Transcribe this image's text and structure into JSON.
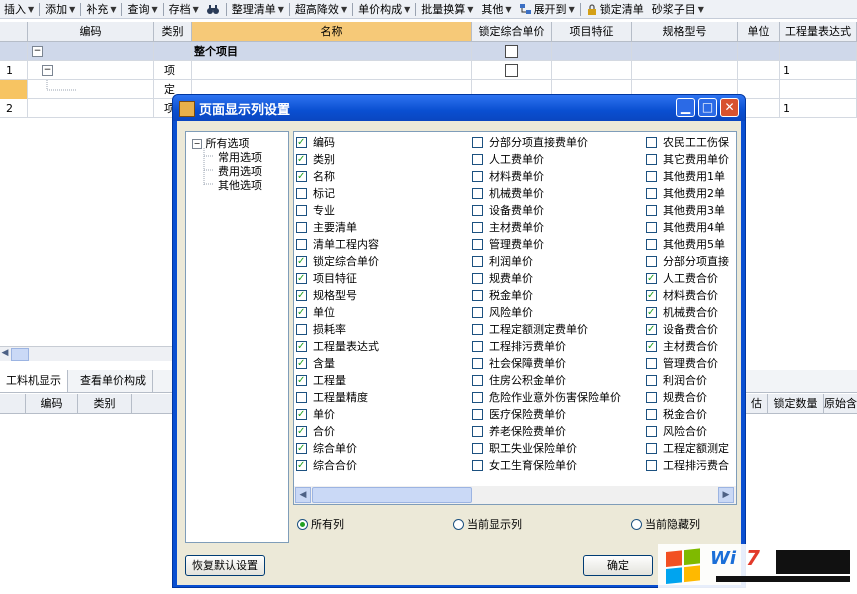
{
  "toolbar": {
    "items": [
      "插入",
      "添加",
      "补充",
      "查询",
      "存档",
      "整理清单",
      "超高降效",
      "单价构成",
      "批量换算",
      "其他",
      "展开到",
      "锁定清单",
      "砂浆子目"
    ]
  },
  "grid": {
    "headers": [
      "编码",
      "类别",
      "名称",
      "锁定综合单价",
      "项目特征",
      "规格型号",
      "单位",
      "工程量表达式"
    ],
    "rows": [
      {
        "num": "",
        "expander": "−",
        "name": "整个项目"
      },
      {
        "num": "1",
        "type": "项",
        "quantity": "1"
      },
      {
        "num": "",
        "type": "定"
      },
      {
        "num": "2",
        "type": "项",
        "quantity": "1"
      }
    ]
  },
  "lower_panel": {
    "tabs": [
      "工料机显示",
      "查看单价构成"
    ],
    "headers_left": [
      "编码",
      "类别"
    ],
    "headers_right": [
      "估",
      "锁定数量",
      "原始含"
    ]
  },
  "dialog": {
    "title": "页面显示列设置",
    "tree": {
      "root": "所有选项",
      "children": [
        "常用选项",
        "费用选项",
        "其他选项"
      ]
    },
    "columns": [
      [
        {
          "label": "编码",
          "checked": true
        },
        {
          "label": "类别",
          "checked": true
        },
        {
          "label": "名称",
          "checked": true
        },
        {
          "label": "标记",
          "checked": false
        },
        {
          "label": "专业",
          "checked": false
        },
        {
          "label": "主要清单",
          "checked": false
        },
        {
          "label": "清单工程内容",
          "checked": false
        },
        {
          "label": "锁定综合单价",
          "checked": true
        },
        {
          "label": "项目特征",
          "checked": true
        },
        {
          "label": "规格型号",
          "checked": true
        },
        {
          "label": "单位",
          "checked": true
        },
        {
          "label": "损耗率",
          "checked": false
        },
        {
          "label": "工程量表达式",
          "checked": true
        },
        {
          "label": "含量",
          "checked": true
        },
        {
          "label": "工程量",
          "checked": true
        },
        {
          "label": "工程量精度",
          "checked": false
        },
        {
          "label": "单价",
          "checked": true
        },
        {
          "label": "合价",
          "checked": true
        },
        {
          "label": "综合单价",
          "checked": true
        },
        {
          "label": "综合合价",
          "checked": true
        }
      ],
      [
        {
          "label": "分部分项直接费单价",
          "checked": false
        },
        {
          "label": "人工费单价",
          "checked": false
        },
        {
          "label": "材料费单价",
          "checked": false
        },
        {
          "label": "机械费单价",
          "checked": false
        },
        {
          "label": "设备费单价",
          "checked": false
        },
        {
          "label": "主材费单价",
          "checked": false
        },
        {
          "label": "管理费单价",
          "checked": false
        },
        {
          "label": "利润单价",
          "checked": false
        },
        {
          "label": "规费单价",
          "checked": false
        },
        {
          "label": "税金单价",
          "checked": false
        },
        {
          "label": "风险单价",
          "checked": false
        },
        {
          "label": "工程定额测定费单价",
          "checked": false
        },
        {
          "label": "工程排污费单价",
          "checked": false
        },
        {
          "label": "社会保障费单价",
          "checked": false
        },
        {
          "label": "住房公积金单价",
          "checked": false
        },
        {
          "label": "危险作业意外伤害保险单价",
          "checked": false
        },
        {
          "label": "医疗保险费单价",
          "checked": false
        },
        {
          "label": "养老保险费单价",
          "checked": false
        },
        {
          "label": "职工失业保险单价",
          "checked": false
        },
        {
          "label": "女工生育保险单价",
          "checked": false
        }
      ],
      [
        {
          "label": "农民工工伤保",
          "checked": false
        },
        {
          "label": "其它费用单价",
          "checked": false
        },
        {
          "label": "其他费用1单",
          "checked": false
        },
        {
          "label": "其他费用2单",
          "checked": false
        },
        {
          "label": "其他费用3单",
          "checked": false
        },
        {
          "label": "其他费用4单",
          "checked": false
        },
        {
          "label": "其他费用5单",
          "checked": false
        },
        {
          "label": "分部分项直接",
          "checked": false
        },
        {
          "label": "人工费合价",
          "checked": true
        },
        {
          "label": "材料费合价",
          "checked": true
        },
        {
          "label": "机械费合价",
          "checked": true
        },
        {
          "label": "设备费合价",
          "checked": true
        },
        {
          "label": "主材费合价",
          "checked": true
        },
        {
          "label": "管理费合价",
          "checked": false
        },
        {
          "label": "利润合价",
          "checked": false
        },
        {
          "label": "规费合价",
          "checked": false
        },
        {
          "label": "税金合价",
          "checked": false
        },
        {
          "label": "风险合价",
          "checked": false
        },
        {
          "label": "工程定额测定",
          "checked": false
        },
        {
          "label": "工程排污费合",
          "checked": false
        }
      ]
    ],
    "radios": [
      {
        "label": "所有列",
        "selected": true
      },
      {
        "label": "当前显示列",
        "selected": false
      },
      {
        "label": "当前隐藏列",
        "selected": false
      }
    ],
    "restore_button": "恢复默认设置",
    "ok_button": "确定"
  },
  "watermark": {
    "text_win": "Wi",
    "text_num": "7"
  },
  "colors": {
    "title_bar": "#0a4fd1",
    "dialog_face": "#ece9d8",
    "grid_header": "#eceff4",
    "selected_header": "#f6c978",
    "project_row": "#cfd8ea",
    "check_green": "#21a121",
    "orange_row": "#f7c462"
  }
}
